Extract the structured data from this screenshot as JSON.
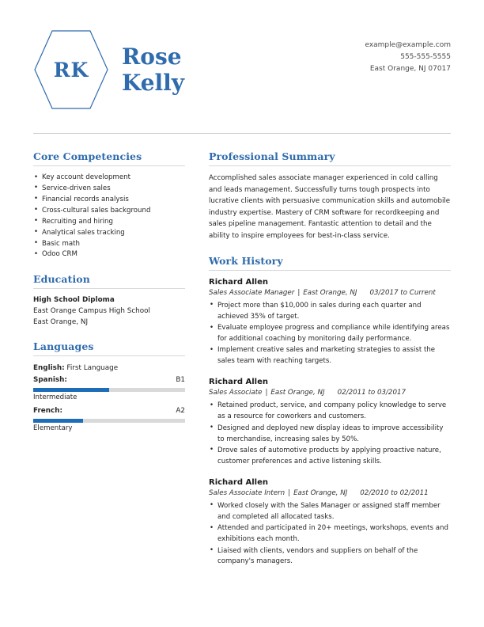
{
  "header": {
    "initials": "RK",
    "first_name": "Rose",
    "last_name": "Kelly",
    "contact": {
      "email": "example@example.com",
      "phone": "555-555-5555",
      "address": "East Orange, NJ 07017"
    }
  },
  "colors": {
    "accent_blue": "#2f6bad",
    "bar_blue": "#1d6cb8",
    "bar_track": "#d9d9d9",
    "rule_gray": "#d8d8d8",
    "text": "#262626"
  },
  "left": {
    "core_competencies": {
      "title": "Core Competencies",
      "items": [
        "Key account development",
        "Service-driven sales",
        "Financial records analysis",
        "Cross-cultural sales background",
        "Recruiting and hiring",
        "Analytical sales tracking",
        "Basic math",
        "Odoo CRM"
      ]
    },
    "education": {
      "title": "Education",
      "degree": "High School Diploma",
      "school": "East Orange Campus High School",
      "location": "East Orange, NJ"
    },
    "languages": {
      "title": "Languages",
      "first_language_label": "English:",
      "first_language_value": "First Language",
      "items": [
        {
          "name": "Spanish:",
          "level_code": "B1",
          "level_name": "Intermediate",
          "fill_percent": 50
        },
        {
          "name": "French:",
          "level_code": "A2",
          "level_name": "Elementary",
          "fill_percent": 33
        }
      ]
    }
  },
  "right": {
    "summary": {
      "title": "Professional Summary",
      "text": "Accomplished sales associate manager experienced in cold calling and leads management. Successfully turns tough prospects into lucrative clients with persuasive communication skills and automobile industry expertise. Mastery of CRM software for recordkeeping and sales pipeline management. Fantastic attention to detail and the ability to inspire employees for best-in-class service."
    },
    "work_history": {
      "title": "Work History",
      "jobs": [
        {
          "company": "Richard Allen",
          "role": "Sales Associate Manager",
          "location": "East Orange, NJ",
          "dates": "03/2017 to Current",
          "bullets": [
            "Project more than $10,000 in sales during each quarter and achieved 35% of target.",
            "Evaluate employee progress and compliance while identifying areas for additional coaching by monitoring daily performance.",
            "Implement creative sales and marketing strategies to assist the sales team with reaching targets."
          ]
        },
        {
          "company": "Richard Allen",
          "role": "Sales Associate",
          "location": "East Orange, NJ",
          "dates": "02/2011 to 03/2017",
          "bullets": [
            "Retained product, service, and company policy knowledge to serve as a resource for coworkers and customers.",
            "Designed and deployed new display ideas to improve accessibility to merchandise, increasing sales by 50%.",
            "Drove sales of automotive products by applying proactive nature, customer preferences and active listening skills."
          ]
        },
        {
          "company": "Richard Allen",
          "role": "Sales Associate Intern",
          "location": "East Orange, NJ",
          "dates": "02/2010 to 02/2011",
          "bullets": [
            "Worked closely with the Sales Manager or assigned staff member and completed all allocated tasks.",
            "Attended and participated in 20+ meetings, workshops, events and exhibitions each month.",
            "Liaised with clients, vendors and suppliers on behalf of the company's managers."
          ]
        }
      ]
    }
  }
}
